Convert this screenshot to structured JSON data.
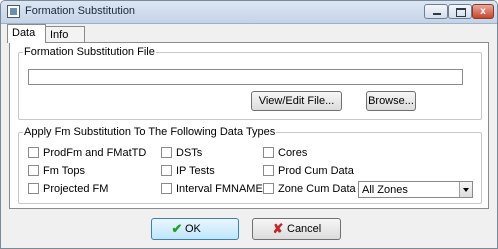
{
  "window": {
    "title": "Formation Substitution",
    "close_glyph": "x"
  },
  "tabs": [
    {
      "label": "Data"
    },
    {
      "label": "Info"
    }
  ],
  "file_section": {
    "legend": "Formation Substitution File",
    "file_value": "",
    "view_edit_label": "View/Edit File...",
    "browse_label": "Browse..."
  },
  "data_types": {
    "legend": "Apply Fm Substitution To The Following Data Types",
    "items": [
      {
        "label": "ProdFm and FMatTD",
        "checked": false
      },
      {
        "label": "DSTs",
        "checked": false
      },
      {
        "label": "Cores",
        "checked": false
      },
      {
        "label": "Fm Tops",
        "checked": false
      },
      {
        "label": "IP Tests",
        "checked": false
      },
      {
        "label": "Prod Cum Data",
        "checked": false
      },
      {
        "label": "Projected FM",
        "checked": false
      },
      {
        "label": "Interval FMNAME",
        "checked": false
      },
      {
        "label": "Zone Cum Data",
        "checked": false
      }
    ],
    "zone_select": {
      "value": "All Zones"
    }
  },
  "footer": {
    "ok_label": "OK",
    "ok_icon": "check-icon",
    "ok_glyph": "✔",
    "cancel_label": "Cancel",
    "cancel_icon": "x-icon",
    "cancel_glyph": "✘"
  },
  "colors": {
    "titlebar": "#c4d4e8",
    "ok_icon": "#2a9d2a",
    "cancel_icon": "#c0282a"
  }
}
